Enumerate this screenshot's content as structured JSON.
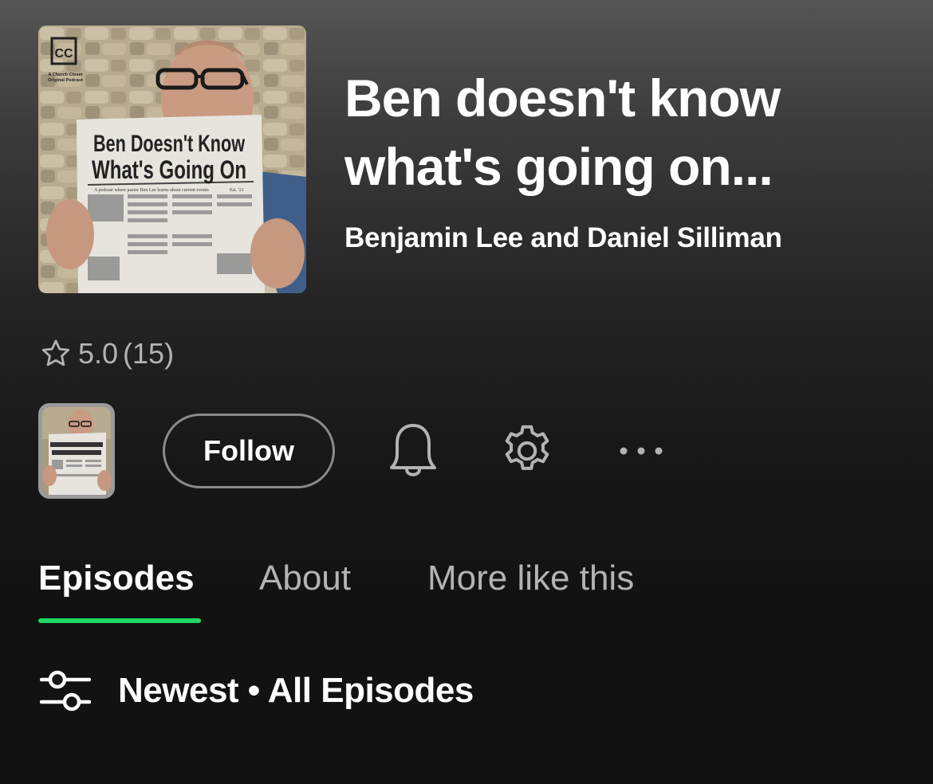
{
  "podcast": {
    "title": "Ben doesn't know what's going on...",
    "author": "Benjamin Lee and Daniel Silliman",
    "cover_art": {
      "logo_text": "CC",
      "logo_caption_1": "A Church Closet",
      "logo_caption_2": "Original Podcast",
      "headline_line1": "Ben Doesn't Know",
      "headline_line2": "What's Going On",
      "tagline": "A podcast where pastor Ben Lee learns about current events",
      "est": "Est. '21"
    },
    "cover_icon": "podcast-cover-image"
  },
  "rating": {
    "icon": "star-outline-icon",
    "score": "5.0",
    "count": "(15)"
  },
  "actions": {
    "follow_label": "Follow",
    "bell_icon": "bell-icon",
    "settings_icon": "gear-icon",
    "more_icon": "more-horizontal-icon"
  },
  "tabs": [
    {
      "label": "Episodes",
      "active": true
    },
    {
      "label": "About",
      "active": false
    },
    {
      "label": "More like this",
      "active": false
    }
  ],
  "sort": {
    "icon": "sliders-icon",
    "label": "Newest • All Episodes"
  },
  "colors": {
    "accent": "#1ed760",
    "text_primary": "#ffffff",
    "text_secondary": "#b3b3b3",
    "background": "#121212"
  }
}
